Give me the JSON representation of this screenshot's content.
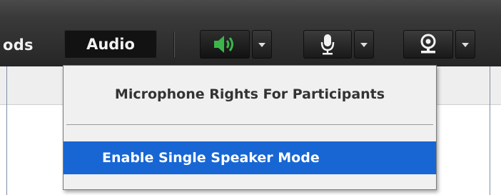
{
  "toolbar": {
    "partial_menu_label": "ods",
    "audio_tab_label": "Audio",
    "speaker_icon": "speaker-on-icon",
    "mic_icon": "microphone-icon",
    "webcam_icon": "webcam-icon",
    "speaker_active_color": "#3bb54a"
  },
  "dropdown": {
    "item_microphone_rights": "Microphone Rights For Participants",
    "item_single_speaker": "Enable Single Speaker Mode",
    "highlight_color": "#1766d4"
  }
}
